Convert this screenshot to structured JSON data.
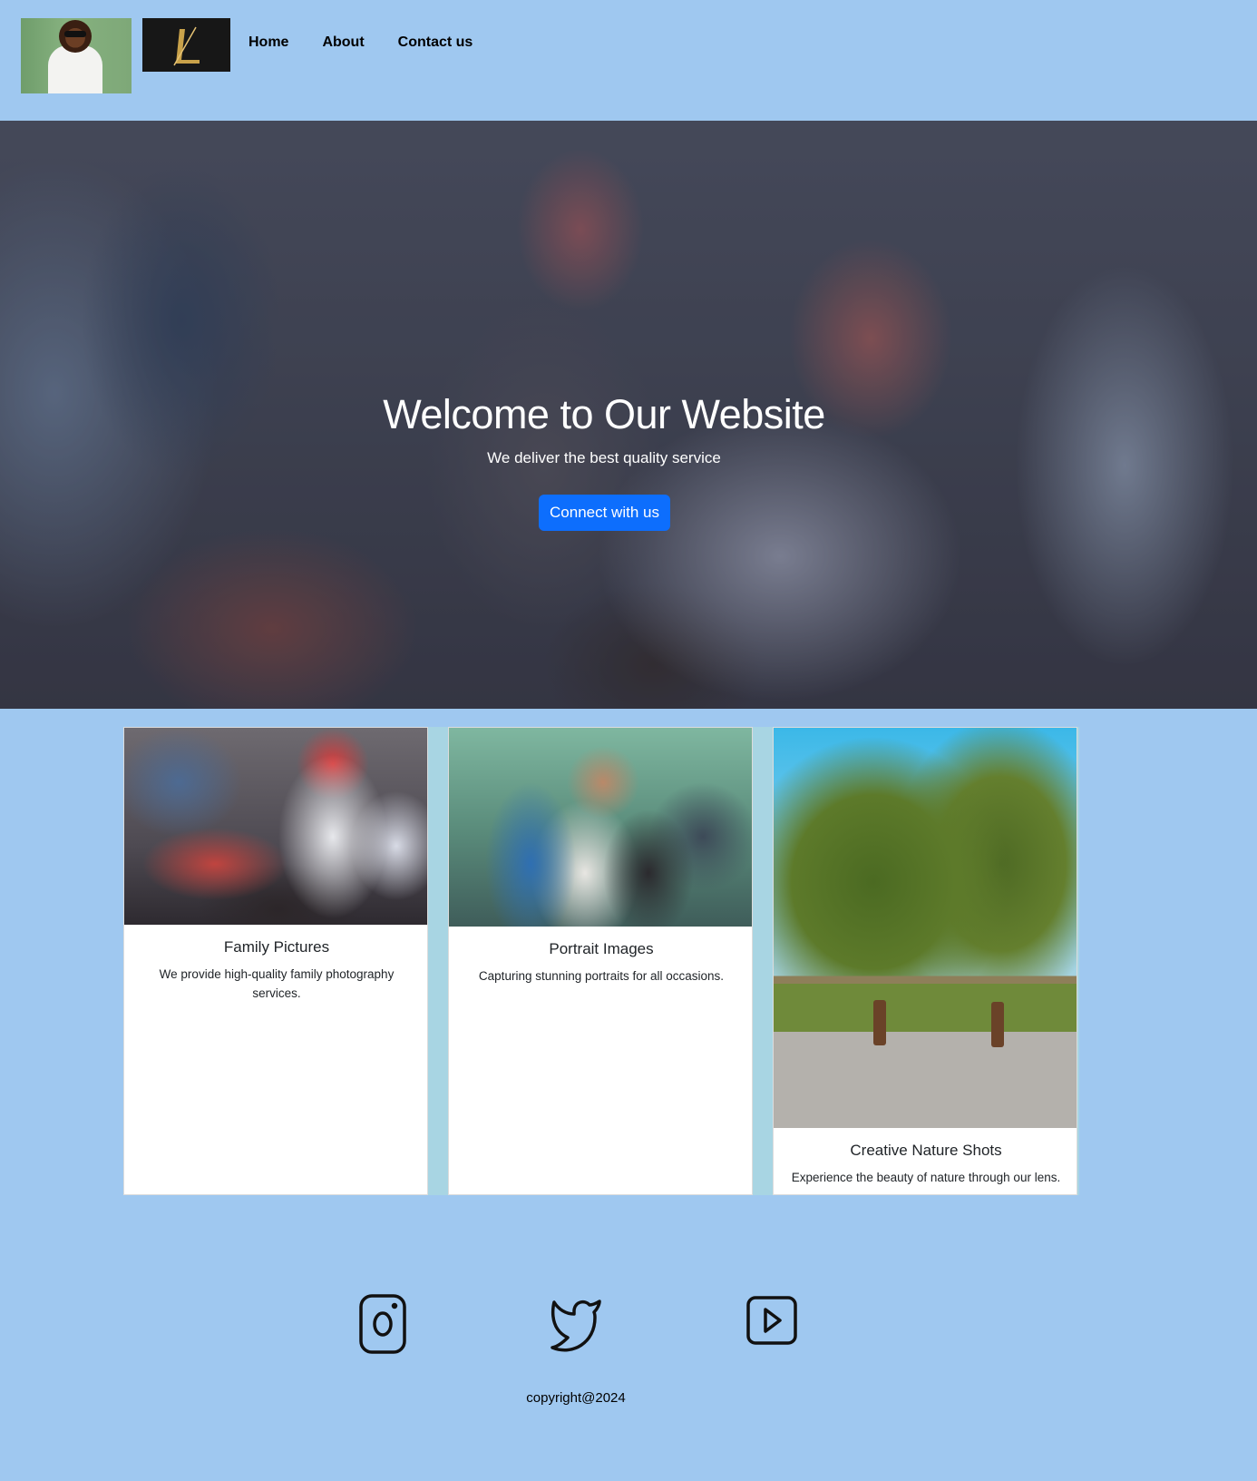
{
  "nav": {
    "links": [
      "Home",
      "About",
      "Contact us"
    ]
  },
  "hero": {
    "title": "Welcome to Our Website",
    "subtitle": "We deliver the best quality service",
    "button_label": "Connect with us"
  },
  "cards": [
    {
      "title": "Family Pictures",
      "text": "We provide high-quality family photography services."
    },
    {
      "title": "Portrait Images",
      "text": "Capturing stunning portraits for all occasions."
    },
    {
      "title": "Creative Nature Shots",
      "text": "Experience the beauty of nature through our lens."
    }
  ],
  "footer": {
    "social_icons": [
      "instagram-icon",
      "twitter-icon",
      "youtube-icon"
    ],
    "copyright": "copyright@2024"
  },
  "colors": {
    "page_background": "#9fc8f0",
    "button": "#0d6efd",
    "card_band": "#a8d5e3"
  }
}
